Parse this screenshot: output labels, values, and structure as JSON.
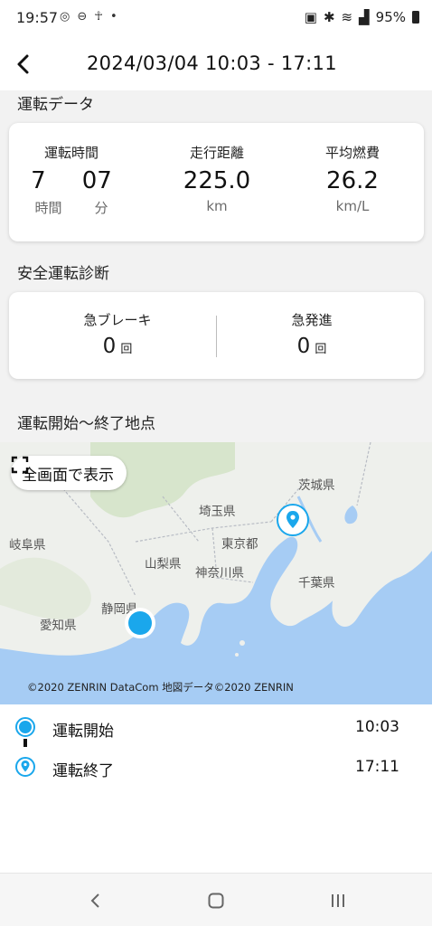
{
  "status": {
    "time": "19:57",
    "battery": "95%"
  },
  "header": {
    "title": "2024/03/04 10:03 - 17:11"
  },
  "drive_data": {
    "section_title": "運転データ",
    "time": {
      "label": "運転時間",
      "hours": "7",
      "minutes": "07",
      "hours_unit": "時間",
      "minutes_unit": "分"
    },
    "distance": {
      "label": "走行距離",
      "value": "225.0",
      "unit": "km"
    },
    "fuel": {
      "label": "平均燃費",
      "value": "26.2",
      "unit": "km/L"
    }
  },
  "safety": {
    "section_title": "安全運転診断",
    "brake": {
      "label": "急ブレーキ",
      "value": "0",
      "unit": "回"
    },
    "start": {
      "label": "急発進",
      "value": "0",
      "unit": "回"
    }
  },
  "route": {
    "section_title": "運転開始〜終了地点",
    "fullscreen_label": "全画面で表示",
    "copyright": "©2020 ZENRIN DataCom 地図データ©2020 ZENRIN",
    "prefectures": {
      "ibaraki": "茨城県",
      "saitama": "埼玉県",
      "gifu": "岐阜県",
      "tokyo": "東京都",
      "yamanashi": "山梨県",
      "kanagawa": "神奈川県",
      "chiba": "千葉県",
      "shizuoka": "静岡県",
      "aichi": "愛知県"
    }
  },
  "legend": {
    "start_label": "運転開始",
    "start_time": "10:03",
    "end_label": "運転終了",
    "end_time": "17:11"
  },
  "colors": {
    "accent": "#1aa7ec",
    "sea": "#a6ccf4",
    "land": "#eef0ec"
  }
}
